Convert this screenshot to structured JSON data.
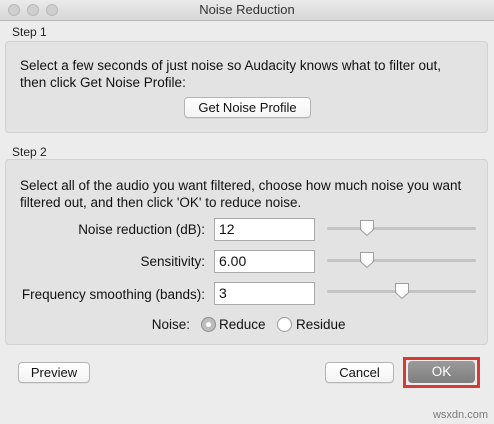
{
  "window": {
    "title": "Noise Reduction"
  },
  "step1": {
    "label": "Step 1",
    "description_line1": "Select a few seconds of just noise so Audacity knows what to filter out,",
    "description_line2": "then click Get Noise Profile:",
    "profile_button": "Get Noise Profile"
  },
  "step2": {
    "label": "Step 2",
    "description_line1": "Select all of the audio you want filtered, choose how much noise you want",
    "description_line2": "filtered out, and then click 'OK' to reduce noise.",
    "fields": [
      {
        "label": "Noise reduction (dB):",
        "value": "12",
        "slider_fraction": 0.27
      },
      {
        "label": "Sensitivity:",
        "value": "6.00",
        "slider_fraction": 0.27
      },
      {
        "label": "Frequency smoothing (bands):",
        "value": "3",
        "slider_fraction": 0.5
      }
    ],
    "noise_label": "Noise:",
    "noise_options": [
      {
        "label": "Reduce",
        "selected": true
      },
      {
        "label": "Residue",
        "selected": false
      }
    ]
  },
  "buttons": {
    "preview": "Preview",
    "cancel": "Cancel",
    "ok": "OK"
  },
  "watermark": "wsxdn.com",
  "colors": {
    "highlight": "#d73a32",
    "ok_button": "#8a8a8a"
  }
}
